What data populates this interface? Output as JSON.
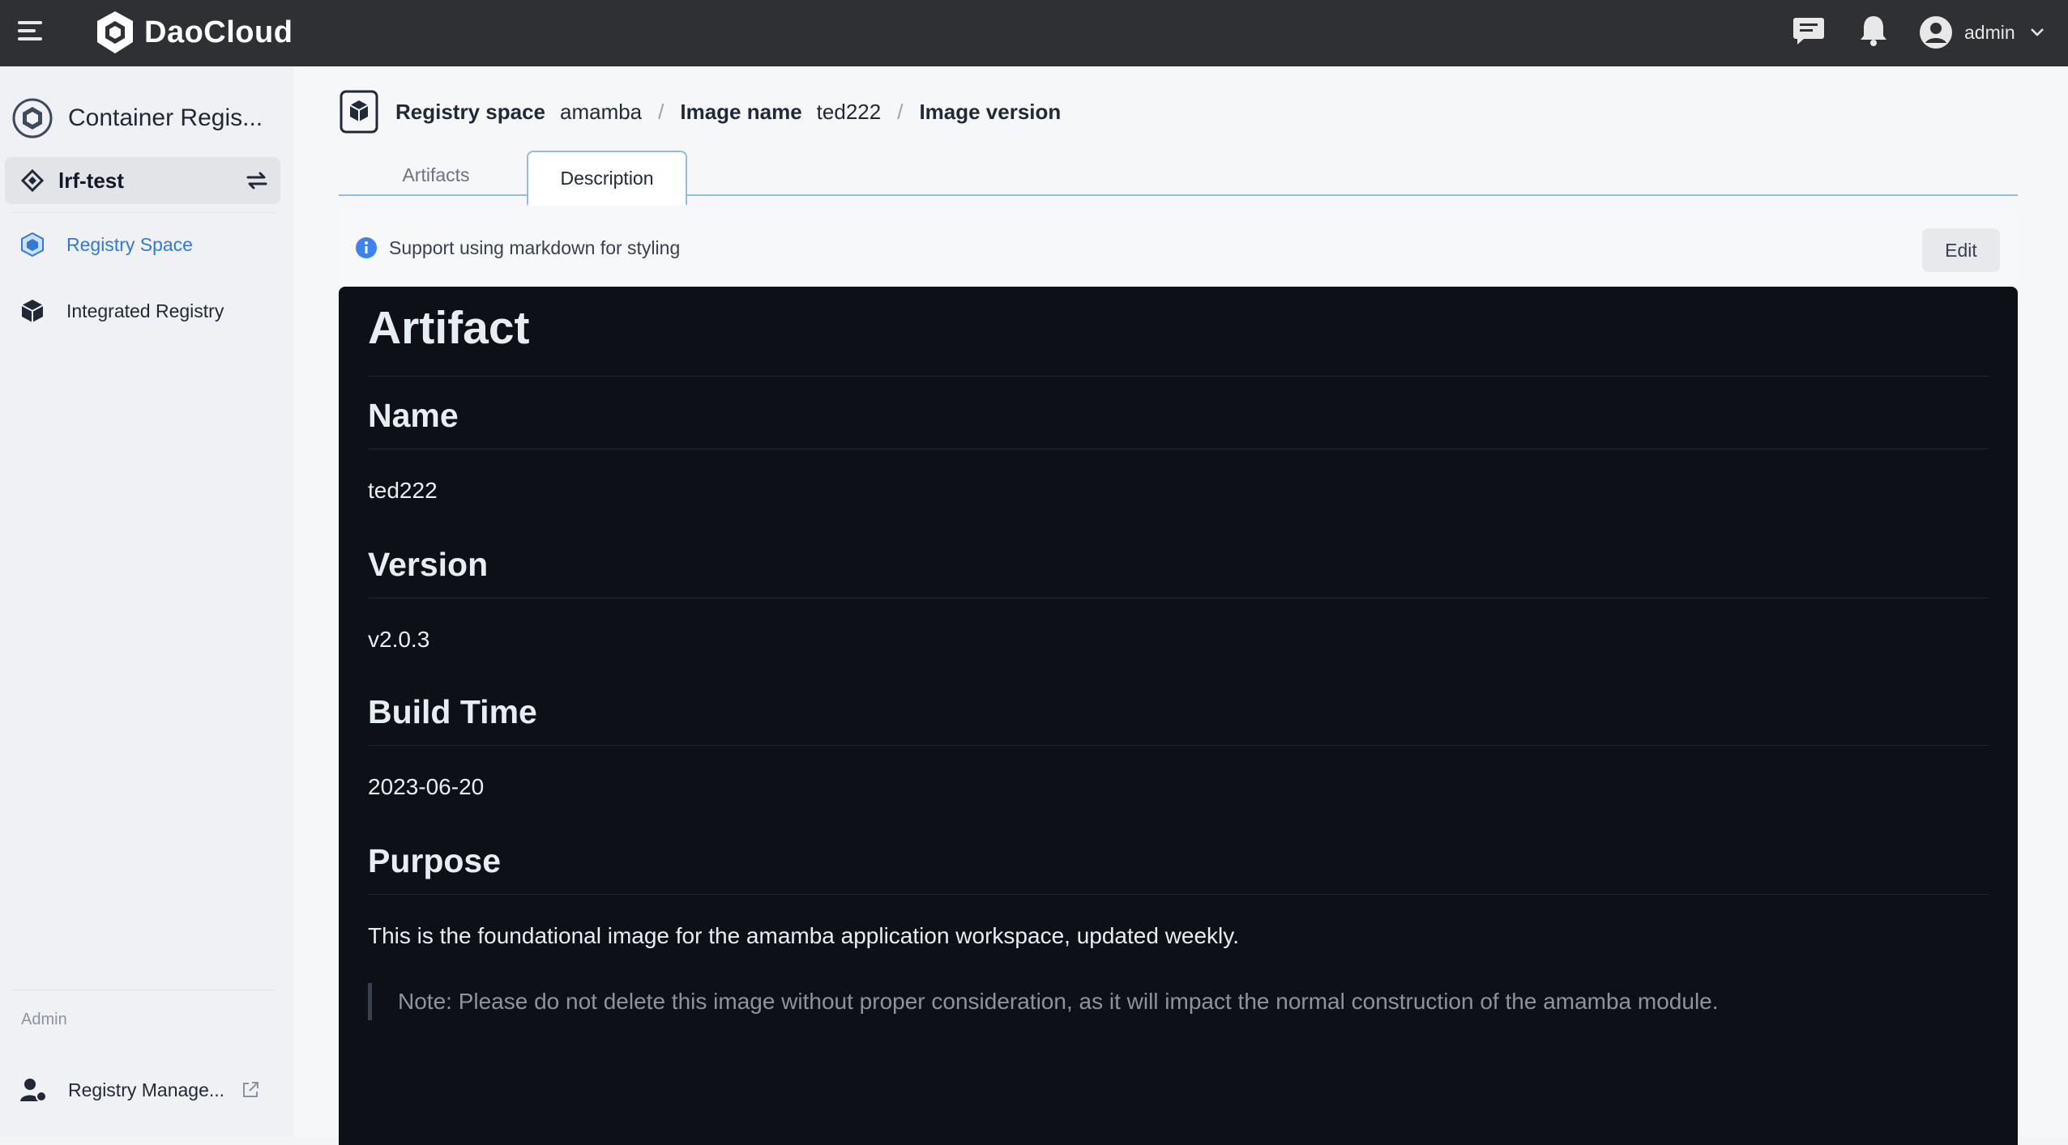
{
  "topbar": {
    "brand": "DaoCloud",
    "user_name": "admin",
    "icons": [
      "menu-icon",
      "chat-icon",
      "bell-icon",
      "user-avatar-icon",
      "chevron-down-icon"
    ]
  },
  "sidebar": {
    "module_title": "Container Regis...",
    "workspace": "lrf-test",
    "items": [
      {
        "label": "Registry Space",
        "active": true
      },
      {
        "label": "Integrated Registry",
        "active": false
      }
    ],
    "admin_section": "Admin",
    "admin_items": [
      {
        "label": "Registry Manage..."
      }
    ]
  },
  "breadcrumb": {
    "registry_key": "Registry space",
    "registry_val": "amamba",
    "image_key": "Image name",
    "image_val": "ted222",
    "version_key": "Image version"
  },
  "tabs": [
    {
      "label": "Artifacts",
      "active": false
    },
    {
      "label": "Description",
      "active": true
    }
  ],
  "notice": {
    "text": "Support using markdown for styling",
    "edit_label": "Edit"
  },
  "markdown": {
    "h1": "Artifact",
    "name_heading": "Name",
    "name_value": "ted222",
    "version_heading": "Version",
    "version_value": "v2.0.3",
    "build_heading": "Build Time",
    "build_value": "2023-06-20",
    "purpose_heading": "Purpose",
    "purpose_text": "This is the foundational image for the amamba application workspace, updated weekly.",
    "note": "Note: Please do not delete this image without proper consideration, as it will impact the normal construction of the amamba module."
  },
  "colors": {
    "topbar": "#2f3033",
    "accent": "#2f7bd6",
    "markdown_bg": "#0d1117",
    "info_icon": "#3b82f6"
  }
}
